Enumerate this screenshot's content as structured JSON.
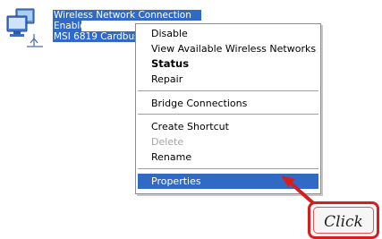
{
  "connection": {
    "name": "Wireless Network Connection",
    "status": "Enabled",
    "device": "MSI 6819 Cardbus",
    "icon": "network-adapter-icon"
  },
  "context_menu": {
    "items": [
      {
        "label": "Disable"
      },
      {
        "label": "View Available Wireless Networks"
      },
      {
        "label": "Status"
      },
      {
        "label": "Repair"
      },
      {
        "label": "Bridge Connections"
      },
      {
        "label": "Create Shortcut"
      },
      {
        "label": "Delete"
      },
      {
        "label": "Rename"
      },
      {
        "label": "Properties"
      }
    ],
    "default_item": "Status",
    "disabled_item": "Delete",
    "selected_item": "Properties"
  },
  "callout": {
    "label": "Click"
  },
  "colors": {
    "selection": "#316ac5",
    "callout_border": "#d41f1f",
    "disabled_text": "#a6a6a6"
  }
}
